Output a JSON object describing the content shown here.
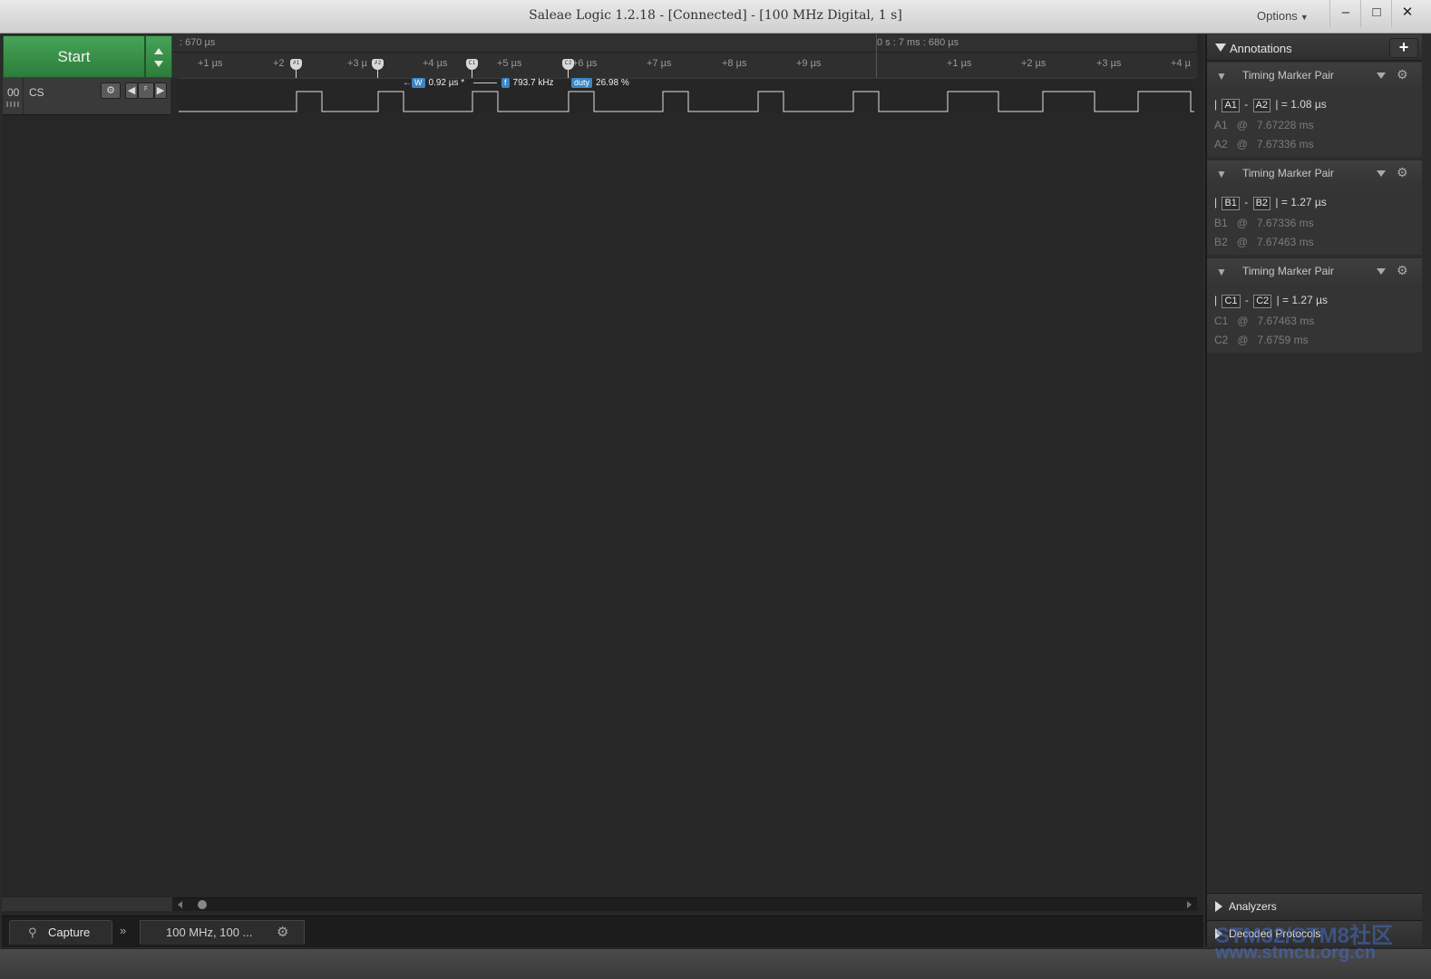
{
  "window": {
    "title": "Saleae Logic 1.2.18 - [Connected] - [100 MHz Digital, 1 s]",
    "options_label": "Options",
    "minimize_glyph": "–",
    "maximize_glyph": "□",
    "close_glyph": "✕"
  },
  "start": {
    "label": "Start"
  },
  "channel": {
    "number": "00",
    "name": "CS",
    "edge_glyph": "⸁"
  },
  "ruler": {
    "left_time": ": 670 µs",
    "mid_time": "0 s : 7 ms : 680 µs",
    "ticks": [
      "+1 µs",
      "+2",
      "+3 µ",
      "+4 µs",
      "+5 µs",
      "+6 µs",
      "+7 µs",
      "+8 µs",
      "+9 µs",
      "+1 µs",
      "+2 µs",
      "+3 µs",
      "+4 µ"
    ]
  },
  "measurements": {
    "width_badge": "W",
    "width_value": "0.92 µs *",
    "freq_badge": "f",
    "freq_value": "793.7 kHz",
    "duty_badge": "duty",
    "duty_value": "26.98 %"
  },
  "markers": [
    "A1",
    "A2",
    "C1",
    "C2"
  ],
  "bottom": {
    "capture_label": "Capture",
    "capture_settings": "100 MHz, 100 ..."
  },
  "annotations": {
    "header": "Annotations",
    "add_glyph": "+",
    "pairs": [
      {
        "title": "Timing Marker Pair",
        "m1": "A1",
        "m2": "A2",
        "diff": "1.08 µs",
        "t1_label": "A1",
        "t1": "7.67228 ms",
        "t2_label": "A2",
        "t2": "7.67336 ms"
      },
      {
        "title": "Timing Marker Pair",
        "m1": "B1",
        "m2": "B2",
        "diff": "1.27 µs",
        "t1_label": "B1",
        "t1": "7.67336 ms",
        "t2_label": "B2",
        "t2": "7.67463 ms"
      },
      {
        "title": "Timing Marker Pair",
        "m1": "C1",
        "m2": "C2",
        "diff": "1.27 µs",
        "t1_label": "C1",
        "t1": "7.67463 ms",
        "t2_label": "C2",
        "t2": "7.6759 ms"
      }
    ]
  },
  "sections": {
    "analyzers": "Analyzers",
    "decoded": "Decoded Protocols"
  },
  "watermark": {
    "line1": "STM32/STM8社区",
    "line2": "www.stmcu.org.cn"
  }
}
